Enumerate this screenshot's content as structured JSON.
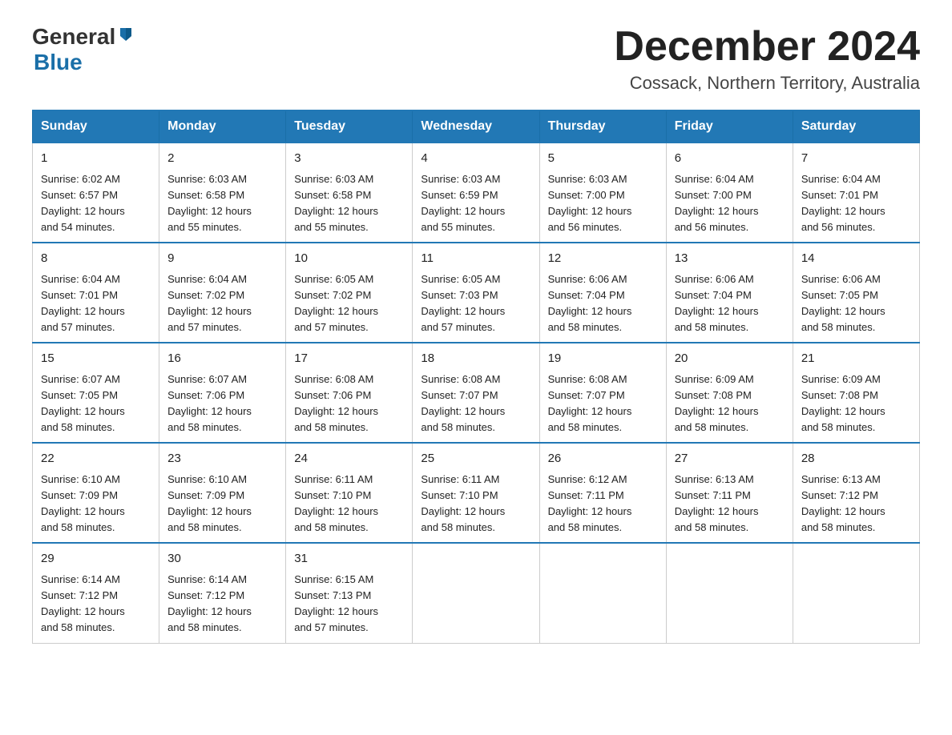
{
  "header": {
    "logo_general": "General",
    "logo_blue": "Blue",
    "month_title": "December 2024",
    "location": "Cossack, Northern Territory, Australia"
  },
  "days_of_week": [
    "Sunday",
    "Monday",
    "Tuesday",
    "Wednesday",
    "Thursday",
    "Friday",
    "Saturday"
  ],
  "weeks": [
    [
      {
        "day": "1",
        "sunrise": "6:02 AM",
        "sunset": "6:57 PM",
        "daylight": "12 hours and 54 minutes."
      },
      {
        "day": "2",
        "sunrise": "6:03 AM",
        "sunset": "6:58 PM",
        "daylight": "12 hours and 55 minutes."
      },
      {
        "day": "3",
        "sunrise": "6:03 AM",
        "sunset": "6:58 PM",
        "daylight": "12 hours and 55 minutes."
      },
      {
        "day": "4",
        "sunrise": "6:03 AM",
        "sunset": "6:59 PM",
        "daylight": "12 hours and 55 minutes."
      },
      {
        "day": "5",
        "sunrise": "6:03 AM",
        "sunset": "7:00 PM",
        "daylight": "12 hours and 56 minutes."
      },
      {
        "day": "6",
        "sunrise": "6:04 AM",
        "sunset": "7:00 PM",
        "daylight": "12 hours and 56 minutes."
      },
      {
        "day": "7",
        "sunrise": "6:04 AM",
        "sunset": "7:01 PM",
        "daylight": "12 hours and 56 minutes."
      }
    ],
    [
      {
        "day": "8",
        "sunrise": "6:04 AM",
        "sunset": "7:01 PM",
        "daylight": "12 hours and 57 minutes."
      },
      {
        "day": "9",
        "sunrise": "6:04 AM",
        "sunset": "7:02 PM",
        "daylight": "12 hours and 57 minutes."
      },
      {
        "day": "10",
        "sunrise": "6:05 AM",
        "sunset": "7:02 PM",
        "daylight": "12 hours and 57 minutes."
      },
      {
        "day": "11",
        "sunrise": "6:05 AM",
        "sunset": "7:03 PM",
        "daylight": "12 hours and 57 minutes."
      },
      {
        "day": "12",
        "sunrise": "6:06 AM",
        "sunset": "7:04 PM",
        "daylight": "12 hours and 58 minutes."
      },
      {
        "day": "13",
        "sunrise": "6:06 AM",
        "sunset": "7:04 PM",
        "daylight": "12 hours and 58 minutes."
      },
      {
        "day": "14",
        "sunrise": "6:06 AM",
        "sunset": "7:05 PM",
        "daylight": "12 hours and 58 minutes."
      }
    ],
    [
      {
        "day": "15",
        "sunrise": "6:07 AM",
        "sunset": "7:05 PM",
        "daylight": "12 hours and 58 minutes."
      },
      {
        "day": "16",
        "sunrise": "6:07 AM",
        "sunset": "7:06 PM",
        "daylight": "12 hours and 58 minutes."
      },
      {
        "day": "17",
        "sunrise": "6:08 AM",
        "sunset": "7:06 PM",
        "daylight": "12 hours and 58 minutes."
      },
      {
        "day": "18",
        "sunrise": "6:08 AM",
        "sunset": "7:07 PM",
        "daylight": "12 hours and 58 minutes."
      },
      {
        "day": "19",
        "sunrise": "6:08 AM",
        "sunset": "7:07 PM",
        "daylight": "12 hours and 58 minutes."
      },
      {
        "day": "20",
        "sunrise": "6:09 AM",
        "sunset": "7:08 PM",
        "daylight": "12 hours and 58 minutes."
      },
      {
        "day": "21",
        "sunrise": "6:09 AM",
        "sunset": "7:08 PM",
        "daylight": "12 hours and 58 minutes."
      }
    ],
    [
      {
        "day": "22",
        "sunrise": "6:10 AM",
        "sunset": "7:09 PM",
        "daylight": "12 hours and 58 minutes."
      },
      {
        "day": "23",
        "sunrise": "6:10 AM",
        "sunset": "7:09 PM",
        "daylight": "12 hours and 58 minutes."
      },
      {
        "day": "24",
        "sunrise": "6:11 AM",
        "sunset": "7:10 PM",
        "daylight": "12 hours and 58 minutes."
      },
      {
        "day": "25",
        "sunrise": "6:11 AM",
        "sunset": "7:10 PM",
        "daylight": "12 hours and 58 minutes."
      },
      {
        "day": "26",
        "sunrise": "6:12 AM",
        "sunset": "7:11 PM",
        "daylight": "12 hours and 58 minutes."
      },
      {
        "day": "27",
        "sunrise": "6:13 AM",
        "sunset": "7:11 PM",
        "daylight": "12 hours and 58 minutes."
      },
      {
        "day": "28",
        "sunrise": "6:13 AM",
        "sunset": "7:12 PM",
        "daylight": "12 hours and 58 minutes."
      }
    ],
    [
      {
        "day": "29",
        "sunrise": "6:14 AM",
        "sunset": "7:12 PM",
        "daylight": "12 hours and 58 minutes."
      },
      {
        "day": "30",
        "sunrise": "6:14 AM",
        "sunset": "7:12 PM",
        "daylight": "12 hours and 58 minutes."
      },
      {
        "day": "31",
        "sunrise": "6:15 AM",
        "sunset": "7:13 PM",
        "daylight": "12 hours and 57 minutes."
      },
      null,
      null,
      null,
      null
    ]
  ],
  "labels": {
    "sunrise": "Sunrise:",
    "sunset": "Sunset:",
    "daylight": "Daylight:"
  }
}
